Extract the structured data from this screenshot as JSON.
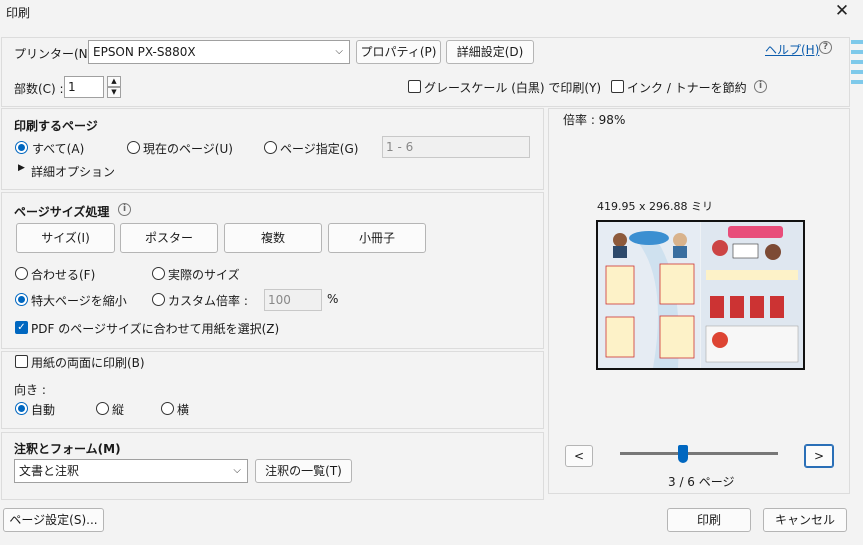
{
  "window": {
    "title": "印刷",
    "close": "✕"
  },
  "printer": {
    "label": "プリンター(N) :",
    "selected": "EPSON PX-S880X",
    "properties_button": "プロパティ(P)",
    "advanced_button": "詳細設定(D)",
    "help_link": "ヘルプ(H)"
  },
  "copies": {
    "label": "部数(C) :",
    "value": "1"
  },
  "options": {
    "grayscale": "グレースケール (白黒) で印刷(Y)",
    "save_ink": "インク / トナーを節約"
  },
  "pages": {
    "heading": "印刷するページ",
    "all": "すべて(A)",
    "current": "現在のページ(U)",
    "specify": "ページ指定(G)",
    "range_value": "1 - 6",
    "more_options": "詳細オプション"
  },
  "page_size": {
    "heading": "ページサイズ処理",
    "buttons": [
      "サイズ(I)",
      "ポスター",
      "複数",
      "小冊子"
    ],
    "fit": "合わせる(F)",
    "actual": "実際のサイズ",
    "shrink": "特大ページを縮小",
    "custom": "カスタム倍率 :",
    "custom_value": "100",
    "percent": "%",
    "pdf_paper": "PDF のページサイズに合わせて用紙を選択(Z)"
  },
  "duplex": {
    "both_sides": "用紙の両面に印刷(B)",
    "orientation_label": "向き :",
    "auto": "自動",
    "portrait": "縦",
    "landscape": "横"
  },
  "annotations": {
    "heading": "注釈とフォーム(M)",
    "selected": "文書と注釈",
    "summary_button": "注釈の一覧(T)"
  },
  "preview": {
    "scale": "倍率 : 98%",
    "dimensions": "419.95 x 296.88 ミリ",
    "prev": "<",
    "next": ">",
    "page_counter": "3 / 6 ページ",
    "slider_fraction": 0.4
  },
  "footer": {
    "page_setup": "ページ設定(S)...",
    "print": "印刷",
    "cancel": "キャンセル"
  },
  "colors": {
    "accent": "#0067c0",
    "link": "#0b5cad"
  }
}
